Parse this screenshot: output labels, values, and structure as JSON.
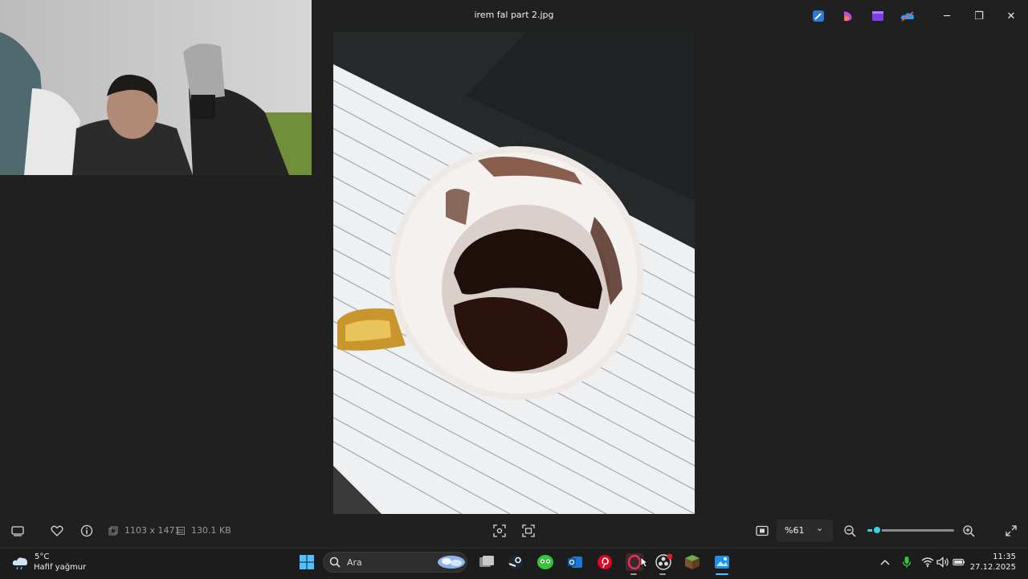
{
  "window": {
    "title": "irem fal part 2.jpg",
    "minimize_glyph": "─",
    "restore_glyph": "❐",
    "close_glyph": "✕",
    "toolbar_icons": [
      "edit-icon",
      "designer-icon",
      "clipchamp-icon",
      "onedrive-icon"
    ]
  },
  "image_info": {
    "dimensions": "1103 x 1471",
    "file_size": "130.1 KB"
  },
  "zoom": {
    "value": "%61",
    "chevron_glyph": "⌄",
    "level_fraction": 0.11
  },
  "bottombar_icons": [
    "filmstrip-icon",
    "heart-icon",
    "info-icon",
    "dimensions-icon",
    "filesize-icon",
    "ai-scan-icon",
    "select-scan-icon",
    "fit-view-icon",
    "zoom-out-icon",
    "zoom-in-icon",
    "fullscreen-icon"
  ],
  "taskbar": {
    "weather": {
      "temp": "5°C",
      "desc": "Hafif yağmur"
    },
    "search_label": "Ara",
    "clock": {
      "time": "11:35",
      "date": "27.12.2025"
    },
    "apps": [
      "start-icon",
      "task-view-icon",
      "steam-icon",
      "xbox-icon",
      "outlook-icon",
      "pinterest-icon",
      "opera-gx-icon",
      "obs-icon",
      "minecraft-icon",
      "photos-icon"
    ],
    "tray": [
      "chevron-up-icon",
      "microphone-icon",
      "wifi-icon",
      "speaker-icon",
      "battery-icon"
    ]
  },
  "colors": {
    "accent": "#3fd0e0",
    "background": "#202020",
    "taskbar": "#1c1c1c"
  }
}
